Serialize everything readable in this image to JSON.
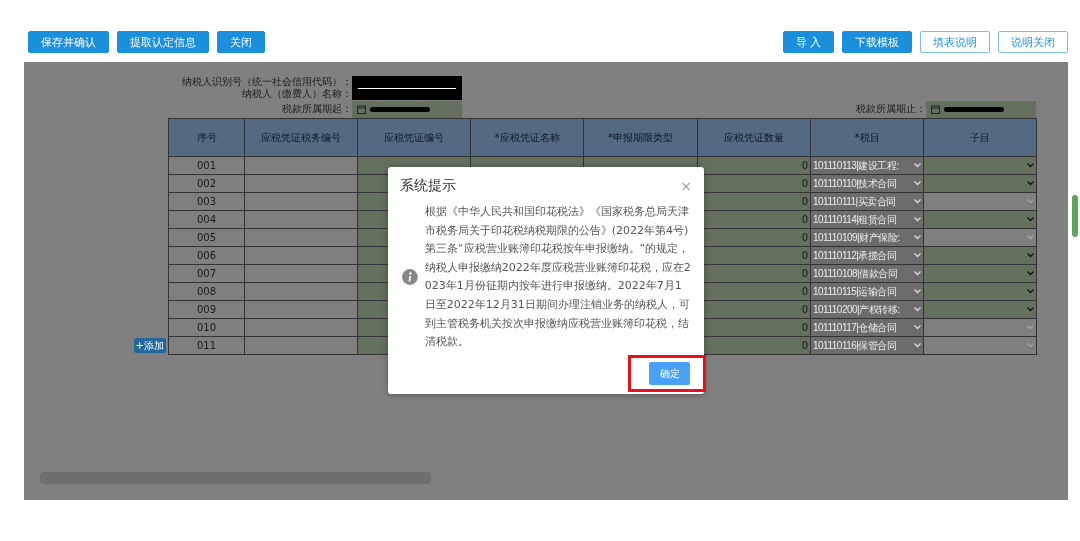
{
  "toolbar": {
    "left_buttons": [
      "保存并确认",
      "提取认定信息",
      "关闭"
    ],
    "right_buttons": [
      {
        "label": "导 入",
        "kind": "solid"
      },
      {
        "label": "下载模板",
        "kind": "solid"
      },
      {
        "label": "填表说明",
        "kind": "outline"
      },
      {
        "label": "说明关闭",
        "kind": "outline"
      }
    ]
  },
  "info": {
    "taxpayer_id_label": "纳税人识别号（统一社会信用代码）：",
    "taxpayer_name_label": "纳税人（缴费人）名称：",
    "period_start_label": "税款所属期起：",
    "period_end_label": "税款所属期止："
  },
  "table": {
    "columns": [
      "序号",
      "应税凭证税务编号",
      "应税凭证编号",
      "*应税凭证名称",
      "*申报期限类型",
      "应税凭证数量",
      "*税目",
      "子目"
    ],
    "rows": [
      {
        "seq": "001",
        "quantity": "0",
        "tax_item": "101110113|建设工程:",
        "sub_item_required": true
      },
      {
        "seq": "002",
        "quantity": "0",
        "tax_item": "101110110|技术合同",
        "sub_item_required": true
      },
      {
        "seq": "003",
        "quantity": "0",
        "tax_item": "101110111|买卖合同",
        "sub_item_required": false
      },
      {
        "seq": "004",
        "quantity": "0",
        "tax_item": "101110114|租赁合同",
        "sub_item_required": true
      },
      {
        "seq": "005",
        "quantity": "0",
        "tax_item": "101110109|财产保险:",
        "sub_item_required": false
      },
      {
        "seq": "006",
        "quantity": "0",
        "tax_item": "101110112|承揽合同",
        "sub_item_required": true
      },
      {
        "seq": "007",
        "quantity": "0",
        "tax_item": "101110108|借款合同",
        "sub_item_required": true
      },
      {
        "seq": "008",
        "quantity": "0",
        "tax_item": "101110115|运输合同",
        "sub_item_required": true
      },
      {
        "seq": "009",
        "quantity": "0",
        "tax_item": "101110200|产权转移:",
        "sub_item_required": true
      },
      {
        "seq": "010",
        "quantity": "0",
        "tax_item": "101110117|仓储合同",
        "sub_item_required": false
      },
      {
        "seq": "011",
        "quantity": "0",
        "tax_item": "101110116|保管合同",
        "sub_item_required": false
      }
    ],
    "add_button": "+添加"
  },
  "dialog": {
    "title": "系统提示",
    "close": "×",
    "message": "根据《中华人民共和国印花税法》《国家税务总局天津市税务局关于印花税纳税期限的公告》(2022年第4号)第三条“应税营业账簿印花税按年申报缴纳。”的规定，纳税人申报缴纳2022年度应税营业账簿印花税，应在2023年1月份征期内按年进行申报缴纳。2022年7月1日至2022年12月31日期间办理注销业务的纳税人，可到主管税务机关按次申报缴纳应税营业账簿印花税，结清税款。",
    "confirm": "确定",
    "confirm_highlighted": true
  }
}
